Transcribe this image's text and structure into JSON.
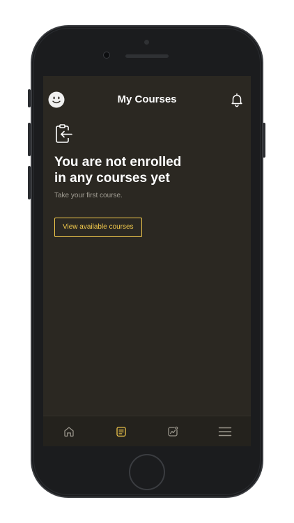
{
  "header": {
    "title": "My Courses",
    "avatar_icon": "smiley-face-icon",
    "notification_icon": "bell-icon"
  },
  "empty_state": {
    "icon": "clipboard-arrow-icon",
    "title": "You are not enrolled in any courses yet",
    "subtitle": "Take your first course.",
    "button_label": "View available courses"
  },
  "bottom_nav": {
    "items": [
      {
        "id": "home",
        "icon": "home-icon",
        "active": false
      },
      {
        "id": "courses",
        "icon": "courses-icon",
        "active": true
      },
      {
        "id": "progress",
        "icon": "progress-chart-icon",
        "active": false
      },
      {
        "id": "menu",
        "icon": "menu-icon",
        "active": false
      }
    ]
  },
  "colors": {
    "accent": "#f2c94c",
    "screen_background": "#2b2822",
    "nav_background": "#24221d",
    "text_primary": "#ffffff",
    "text_secondary": "#a39f95",
    "icon_inactive": "#9a968c"
  }
}
